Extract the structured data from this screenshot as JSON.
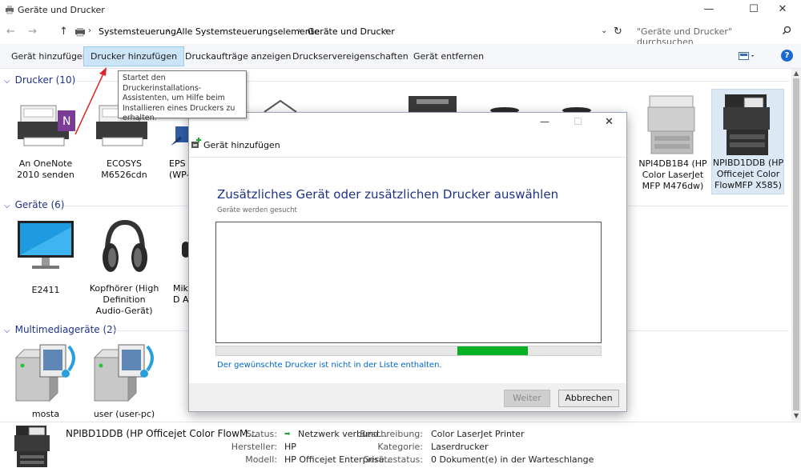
{
  "window": {
    "title": "Geräte und Drucker",
    "controls": {
      "minimize": "—",
      "maximize": "☐",
      "close": "✕"
    }
  },
  "address": {
    "crumbs": [
      "Systemsteuerung",
      "Alle Systemsteuerungselemente",
      "Geräte und Drucker"
    ],
    "search_placeholder": "\"Geräte und Drucker\" durchsuchen"
  },
  "toolbar": {
    "add_device": "Gerät hinzufügen",
    "add_printer": "Drucker hinzufügen",
    "print_jobs": "Druckaufträge anzeigen",
    "server_props": "Druckservereigenschaften",
    "remove_device": "Gerät entfernen",
    "help": "?"
  },
  "tooltip": "Startet den Druckerinstallations-Assistenten, um Hilfe beim Installieren eines Druckers zu erhalten.",
  "groups": {
    "printers": {
      "header": "Drucker (10)",
      "items": [
        {
          "label": "An OneNote 2010 senden"
        },
        {
          "label": "ECOSYS M6526cdn"
        },
        {
          "label": "EPS (WP-"
        },
        {
          "label": "NPI4DB1B4 (HP Color LaserJet MFP M476dw)"
        },
        {
          "label": "NPIBD1DDB (HP Officejet Color FlowMFP X585)"
        }
      ]
    },
    "devices": {
      "header": "Geräte (6)",
      "items": [
        {
          "label": "E2411"
        },
        {
          "label": "Kopfhörer (High Definition Audio-Gerät)"
        },
        {
          "label": "Mikr D Au"
        }
      ]
    },
    "multimedia": {
      "header": "Multimediageräte (2)",
      "items": [
        {
          "label": "mosta"
        },
        {
          "label": "user (user-pc)"
        }
      ]
    }
  },
  "dialog": {
    "title": "Gerät hinzufügen",
    "heading": "Zusätzliches Gerät oder zusätzlichen Drucker auswählen",
    "status": "Geräte werden gesucht",
    "progress": 0.63,
    "link": "Der gewünschte Drucker ist nicht in der Liste enthalten.",
    "next": "Weiter",
    "cancel": "Abbrechen"
  },
  "details": {
    "name": "NPIBD1DDB (HP Officejet Color FlowM...",
    "status_label": "Status:",
    "status_value": "Netzwerk verbund...",
    "manufacturer_label": "Hersteller:",
    "manufacturer_value": "HP",
    "model_label": "Modell:",
    "model_value": "HP Officejet Enterprise...",
    "description_label": "Beschreibung:",
    "description_value": "Color LaserJet Printer",
    "category_label": "Kategorie:",
    "category_value": "Laserdrucker",
    "devstatus_label": "Gerätestatus:",
    "devstatus_value": "0 Dokument(e) in der Warteschlange"
  },
  "colors": {
    "accent": "#1e3287",
    "progress": "#06b025",
    "link": "#0066cc",
    "selection": "#cce4f7"
  }
}
